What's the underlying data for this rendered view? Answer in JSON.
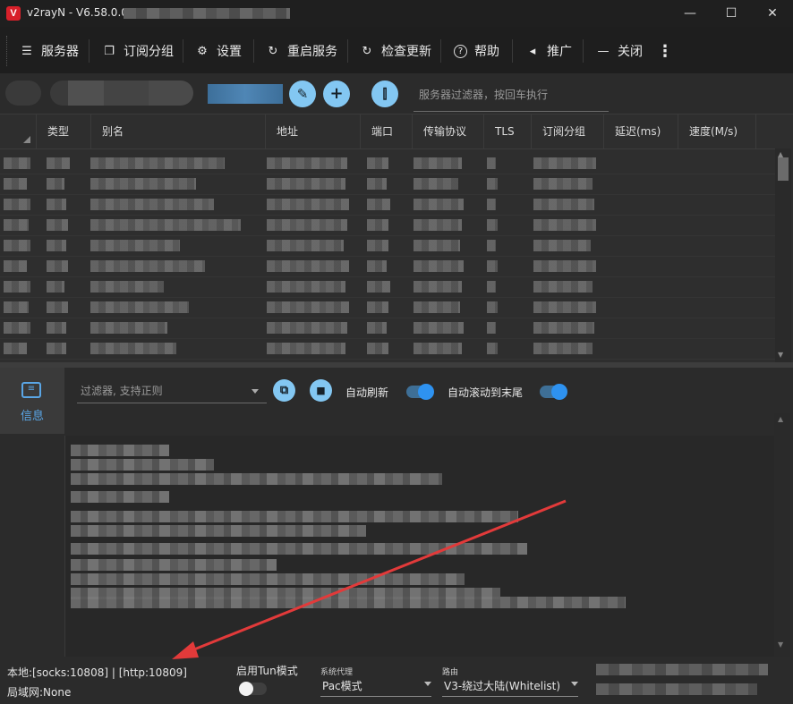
{
  "window": {
    "title": "v2rayN - V6.58.0.0",
    "logo_letter": "V",
    "minimize": "—",
    "maximize": "☐",
    "close": "✕"
  },
  "toolbar": {
    "items": [
      {
        "label": "服务器",
        "icon": "server-icon",
        "glyph": "☰"
      },
      {
        "label": "订阅分组",
        "icon": "subscription-icon",
        "glyph": "❐"
      },
      {
        "label": "设置",
        "icon": "gear-icon",
        "glyph": "⚙"
      },
      {
        "label": "重启服务",
        "icon": "restart-icon",
        "glyph": "↻"
      },
      {
        "label": "检查更新",
        "icon": "update-icon",
        "glyph": "↻"
      },
      {
        "label": "帮助",
        "icon": "help-icon",
        "glyph": "?"
      },
      {
        "label": "推广",
        "icon": "speaker-icon",
        "glyph": "◂"
      },
      {
        "label": "关闭",
        "icon": "minus-icon",
        "glyph": "—"
      }
    ],
    "more_glyph": "⋮"
  },
  "filterbar": {
    "edit_glyph": "✎",
    "add_glyph": "+",
    "speed_glyph": "⫿",
    "placeholder": "服务器过滤器，按回车执行"
  },
  "table": {
    "columns": [
      "类型",
      "别名",
      "地址",
      "端口",
      "传输协议",
      "TLS",
      "订阅分组",
      "延迟(ms)",
      "速度(M/s)"
    ]
  },
  "log": {
    "tab_label": "信息",
    "tab_glyph": "▤",
    "filter_placeholder": "过滤器, 支持正则",
    "copy_glyph": "⧉",
    "clear_glyph": "🗑",
    "auto_refresh_label": "自动刷新",
    "auto_scroll_label": "自动滚动到末尾"
  },
  "status": {
    "local": "本地:[socks:10808] | [http:10809]",
    "lan": "局域网:None",
    "tun_label": "启用Tun模式",
    "sys_proxy_label": "系统代理",
    "sys_proxy_value": "Pac模式",
    "route_label": "路由",
    "route_value": "V3-绕过大陆(Whitelist)"
  },
  "colors": {
    "accent": "#83c7f2",
    "toggle_on": "#2e92f0",
    "arrow": "#e23a3a",
    "background": "#2b2b2b"
  }
}
